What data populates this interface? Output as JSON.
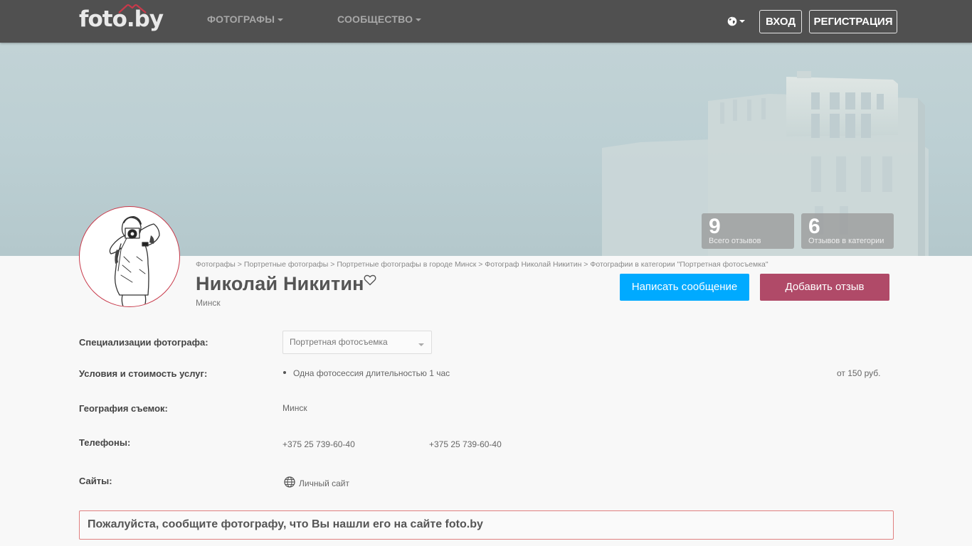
{
  "header": {
    "logo": "foto.by",
    "nav": [
      {
        "label": "ФОТОГРАФЫ"
      },
      {
        "label": "СООБЩЕСТВО"
      }
    ],
    "language_icon": "globe-icon",
    "login_label": "ВХОД",
    "register_label": "РЕГИСТРАЦИЯ"
  },
  "stats": [
    {
      "value": "9",
      "label": "Всего отзывов"
    },
    {
      "value": "6",
      "label": "Отзывов в категории"
    }
  ],
  "breadcrumb": [
    "Фотографы",
    "Портретные фотографы",
    "Портретные фотографы в городе Минск",
    "Фотограф Николай Никитин",
    "Фотографии в категории \"Портретная фотосъемка\""
  ],
  "breadcrumb_separator": ">",
  "profile": {
    "name": "Николай Никитин",
    "city": "Минск",
    "favorite_icon": "heart-icon",
    "message_button": "Написать сообщение",
    "review_button": "Добавить отзыв"
  },
  "info": {
    "specializations_label": "Специализации фотографа:",
    "specialization_selected": "Портретная фотосъемка",
    "services_label": "Условия и стоимость услуг:",
    "service_name": "Одна фотосессия длительностью 1 час",
    "service_price": "от 150 руб.",
    "geography_label": "География съемок:",
    "geography_value": "Минск",
    "phones_label": "Телефоны:",
    "phones": [
      "+375 25 739-60-40",
      "+375 25 739-60-40"
    ],
    "sites_label": "Сайты:",
    "site_link": "Личный сайт"
  },
  "notice": "Пожалуйста, сообщите фотографу, что Вы нашли его на сайте foto.by",
  "colors": {
    "header_bg": "#505050",
    "message_button": "#00aaff",
    "review_button": "#b04a68",
    "notice_border": "#e08080"
  }
}
